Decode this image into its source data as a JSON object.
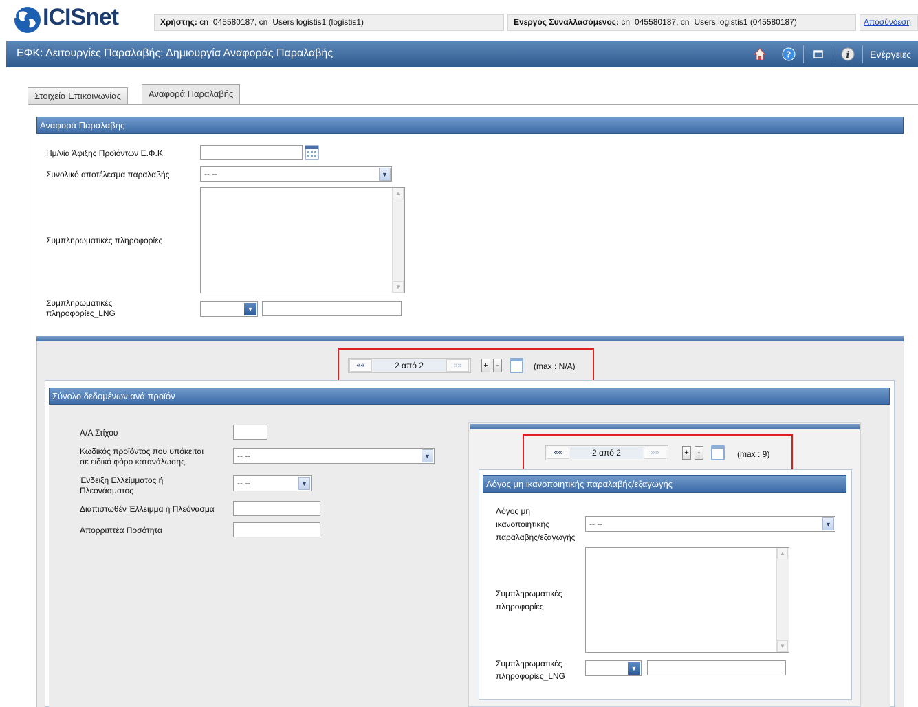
{
  "header": {
    "logo_text": "ICISnet",
    "user_label": "Χρήστης:",
    "user_value": "cn=045580187, cn=Users logistis1 (logistis1)",
    "active_label": "Ενεργός Συναλλασόμενος:",
    "active_value": "cn=045580187, cn=Users logistis1 (045580187)",
    "logout_label": "Αποσύνδεση"
  },
  "titlebar": {
    "title": "ΕΦΚ: Λειτουργίες Παραλαβής: Δημιουργία Αναφοράς Παραλαβής",
    "actions_label": "Ενέργειες",
    "icons": [
      "home-icon",
      "help-icon",
      "window-icon",
      "info-icon"
    ]
  },
  "tabs": [
    {
      "label": "Στοιχεία Επικοινωνίας",
      "active": false
    },
    {
      "label": "Αναφορά Παραλαβής",
      "active": true
    }
  ],
  "report": {
    "header": "Αναφορά Παραλαβής",
    "arrival_date_label": "Ημ/νία Άφιξης Προϊόντων Ε.Φ.Κ.",
    "arrival_date_value": "",
    "overall_result_label": "Συνολικό αποτέλεσμα παραλαβής",
    "overall_result_value": "-- --",
    "extra_info_label": "Συμπληρωματικές πληροφορίες",
    "extra_info_value": "",
    "extra_info_lng_label_1": "Συμπληρωματικές",
    "extra_info_lng_label_2": "πληροφορίες_LNG",
    "extra_info_lng_value": ""
  },
  "pager_outer": {
    "first": "««",
    "text": "2 από 2",
    "last": "»»",
    "plus": "+",
    "minus": "-",
    "max": "(max : N/A)"
  },
  "product_set": {
    "header": "Σύνολο δεδομένων ανά προϊόν",
    "line_no_label": "Α/Α Στίχου",
    "line_no_value": "",
    "product_code_label_1": "Κωδικός προϊόντος που υπόκειται",
    "product_code_label_2": "σε ειδικό φόρο κατανάλωσης",
    "product_code_value": "-- --",
    "shortage_label_1": "Ένδειξη Ελλείμματος ή",
    "shortage_label_2": "Πλεονάσματος",
    "shortage_value": "-- --",
    "observed_label": "Διαπιστωθέν Έλλειμμα ή Πλεόνασμα",
    "observed_value": "",
    "rejected_label": "Απορριπτέα Ποσότητα",
    "rejected_value": ""
  },
  "pager_inner": {
    "first": "««",
    "text": "2 από 2",
    "last": "»»",
    "plus": "+",
    "minus": "-",
    "max": "(max : 9)"
  },
  "reason": {
    "header": "Λόγος μη ικανοποιητικής παραλαβής/εξαγωγής",
    "reason_label_1": "Λόγος μη",
    "reason_label_2": "ικανοποιητικής",
    "reason_label_3": "παραλαβής/εξαγωγής",
    "reason_value": "-- --",
    "extra_info_label_1": "Συμπληρωματικές",
    "extra_info_label_2": "πληροφορίες",
    "extra_info_value": "",
    "extra_info_lng_label_1": "Συμπληρωματικές",
    "extra_info_lng_label_2": "πληροφορίες_LNG",
    "extra_info_lng_value": ""
  },
  "colors": {
    "titlebar": "#2f5a8e",
    "section_header": "#3c6aa6",
    "highlight": "#e02020",
    "link": "#1a46c8"
  }
}
